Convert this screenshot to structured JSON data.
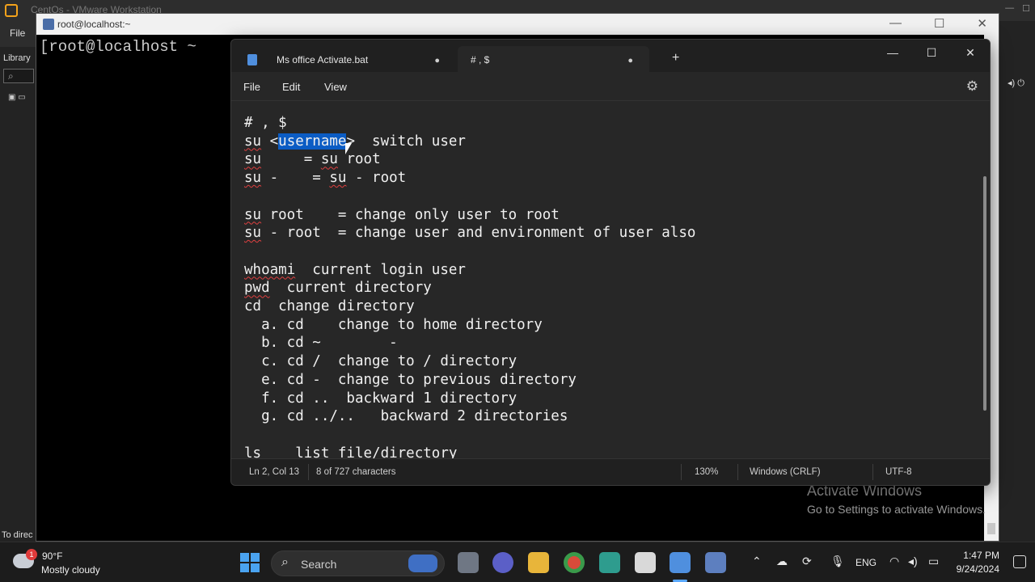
{
  "vmware": {
    "title": "CentOs - VMware Workstation",
    "menu_file": "File",
    "library_label": "Library",
    "status_text": "To direc"
  },
  "console": {
    "title": "root@localhost:~",
    "prompt": "[root@localhost ~"
  },
  "notepad": {
    "tabs": [
      {
        "label": "Ms office Activate.bat",
        "dot": "●"
      },
      {
        "label": "# , $",
        "dot": "●"
      }
    ],
    "new_tab": "+",
    "menu": {
      "file": "File",
      "edit": "Edit",
      "view": "View"
    },
    "lines": {
      "l1": "# , $",
      "l2_a": "su",
      "l2_b": " <",
      "l2_sel": "username",
      "l2_c": ">  switch user",
      "l3_a": "su",
      "l3_b": "     = ",
      "l3_c": "su",
      "l3_d": " root",
      "l4_a": "su",
      "l4_b": " -    = ",
      "l4_c": "su",
      "l4_d": " - root",
      "l5_a": "su",
      "l5_b": " root    = change only user to root",
      "l6_a": "su",
      "l6_b": " - root  = change user and environment of user also",
      "l7_a": "whoami",
      "l7_b": "  current login user",
      "l8_a": "pwd",
      "l8_b": "  current directory",
      "l9": "cd  change directory",
      "l10": "  a. cd    change to home directory",
      "l11": "  b. cd ~        -",
      "l12": "  c. cd /  change to / directory",
      "l13": "  e. cd -  change to previous directory",
      "l14": "  f. cd ..  backward 1 directory",
      "l15": "  g. cd ../..   backward 2 directories",
      "l16": "ls    list file/directory"
    },
    "status": {
      "position": "Ln 2, Col 13",
      "selection": "8 of 727 characters",
      "zoom": "130%",
      "line_ending": "Windows (CRLF)",
      "encoding": "UTF-8"
    }
  },
  "watermark": {
    "line1": "Activate Windows",
    "line2": "Go to Settings to activate Windows."
  },
  "taskbar": {
    "weather_badge": "1",
    "temperature": "90°F",
    "weather_desc": "Mostly cloudy",
    "search_label": "Search",
    "language": "ENG",
    "time": "1:47 PM",
    "date": "9/24/2024"
  },
  "colors": {
    "selection": "#0b5cc4",
    "spellcheck": "#e04040",
    "accent": "#5aa8ff"
  }
}
